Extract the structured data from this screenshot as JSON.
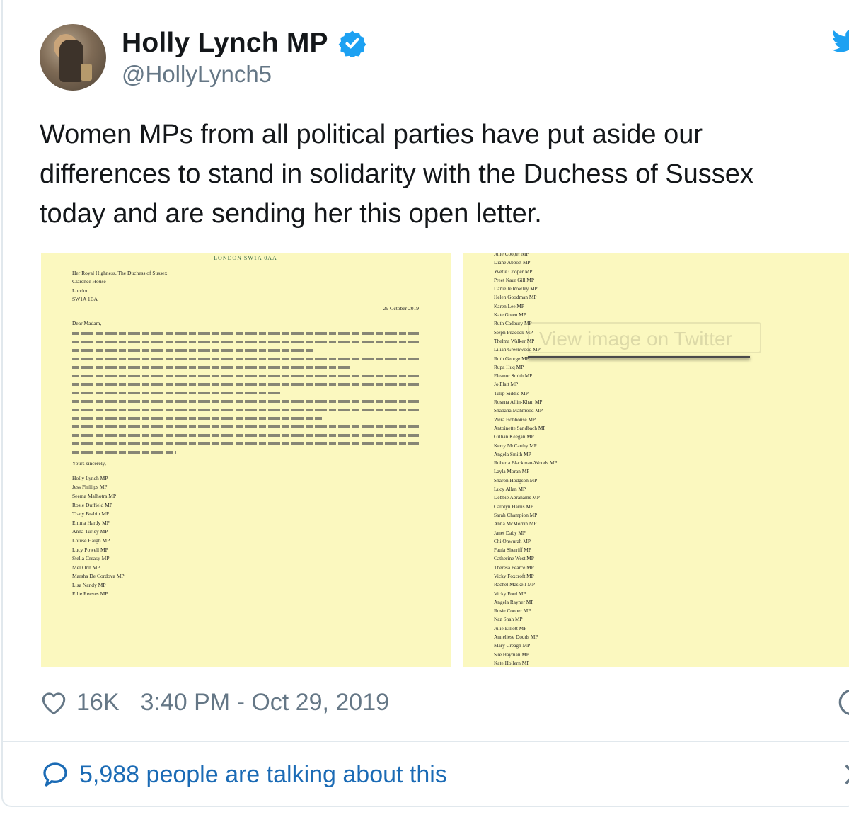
{
  "author": {
    "name": "Holly Lynch MP",
    "handle": "@HollyLynch5"
  },
  "tweet": {
    "lines": [
      "Women MPs from all political parties have put aside our",
      "differences to stand in solidarity with the Duchess of Sussex",
      "today and are sending her this open letter."
    ]
  },
  "letter_left": {
    "header": "LONDON SW1A 0AA",
    "address": [
      "Her Royal Highness, The Duchess of Sussex",
      "Clarence House",
      "London",
      "SW1A 1BA"
    ],
    "date": "29 October 2019",
    "salutation": "Dear Madam,",
    "closing": "Yours sincerely,",
    "signatories": [
      "Holly Lynch MP",
      "Jess Phillips MP",
      "Seema Malhotra MP",
      "Rosie Duffield MP",
      "Tracy Brabin MP",
      "Emma Hardy MP",
      "Anna Turley MP",
      "Louise Haigh MP",
      "Lucy Powell MP",
      "Stella Creasy MP",
      "Mel Onn MP",
      "Marsha De Cordova MP",
      "Lisa Nandy MP",
      "Ellie Reeves MP"
    ]
  },
  "letter_right": {
    "names": [
      "Julie Cooper MP",
      "Diane Abbott MP",
      "Yvette Cooper MP",
      "Preet Kaur Gill MP",
      "Danielle Rowley MP",
      "Helen Goodman MP",
      "Karen Lee MP",
      "Kate Green MP",
      "Ruth Cadbury MP",
      "Steph Peacock MP",
      "Thelma Walker MP",
      "Lilian Greenwood MP",
      "Ruth George MP",
      "Rupa Huq MP",
      "Eleanor Smith MP",
      "Jo Platt MP",
      "Tulip Siddiq MP",
      "Rosena Allin-Khan MP",
      "Shabana Mahmood MP",
      "Wera Hobhouse MP",
      "Antoinette Sandbach MP",
      "Gillian Keegan MP",
      "Kerry McCarthy MP",
      "Angela Smith MP",
      "Roberta Blackman-Woods MP",
      "Layla Moran MP",
      "Sharon Hodgson MP",
      "Lucy Allan MP",
      "Debbie Abrahams MP",
      "Carolyn Harris MP",
      "Sarah Champion MP",
      "Anna McMorrin MP",
      "Janet Daby MP",
      "Chi Onwurah MP",
      "Paula Sherriff MP",
      "Catherine West MP",
      "Theresa Pearce MP",
      "Vicky Foxcroft MP",
      "Rachel Maskell MP",
      "Vicky Ford MP",
      "Angela Rayner MP",
      "Rosie Cooper MP",
      "Naz Shah MP",
      "Julie Elliott MP",
      "Anneliese Dodds MP",
      "Mary Creagh MP",
      "Sue Hayman MP",
      "Kate Hollern MP"
    ]
  },
  "media_overlay": "View image on Twitter",
  "stats": {
    "likes": "16K",
    "timestamp": "3:40 PM - Oct 29, 2019"
  },
  "footer": {
    "talking": "5,988 people are talking about this"
  },
  "colors": {
    "text": "#14171a",
    "muted": "#657786",
    "link": "#1b6bb5",
    "verified": "#1da1f2",
    "paper": "#fbf8bf"
  },
  "icons": [
    "verified-badge-icon",
    "twitter-bird-icon",
    "heart-icon",
    "info-icon",
    "speech-bubble-icon",
    "chevron-right-icon"
  ]
}
